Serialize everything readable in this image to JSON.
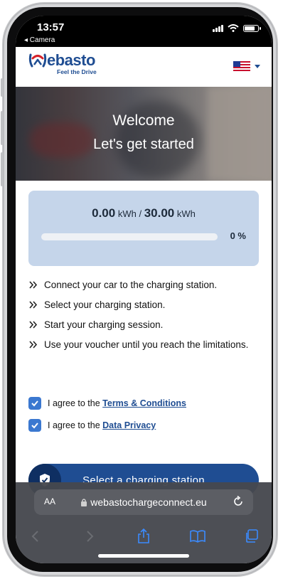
{
  "status": {
    "time": "13:57",
    "back_app": "◂ Camera"
  },
  "header": {
    "brand_rest": "ebasto",
    "tagline": "Feel the Drive",
    "language": "en-US",
    "brand_color": "#1f4d92"
  },
  "hero": {
    "title": "Welcome",
    "subtitle": "Let's get started"
  },
  "energy": {
    "used": "0.00",
    "limit": "30.00",
    "unit": "kWh",
    "separator": "/",
    "percent_label": "0 %",
    "progress_fraction": 0.0
  },
  "steps": [
    "Connect your car to the charging station.",
    "Select your charging station.",
    "Start your charging session.",
    "Use your voucher until you reach the limitations."
  ],
  "agreements": {
    "terms": {
      "prefix": "I agree to the",
      "link": "Terms & Conditions",
      "checked": true
    },
    "privacy": {
      "prefix": "I agree to the",
      "link": "Data Privacy",
      "checked": true
    }
  },
  "cta": {
    "label": "Select a charging station"
  },
  "browser": {
    "aa": "AA",
    "url": "webastochargeconnect.eu"
  }
}
